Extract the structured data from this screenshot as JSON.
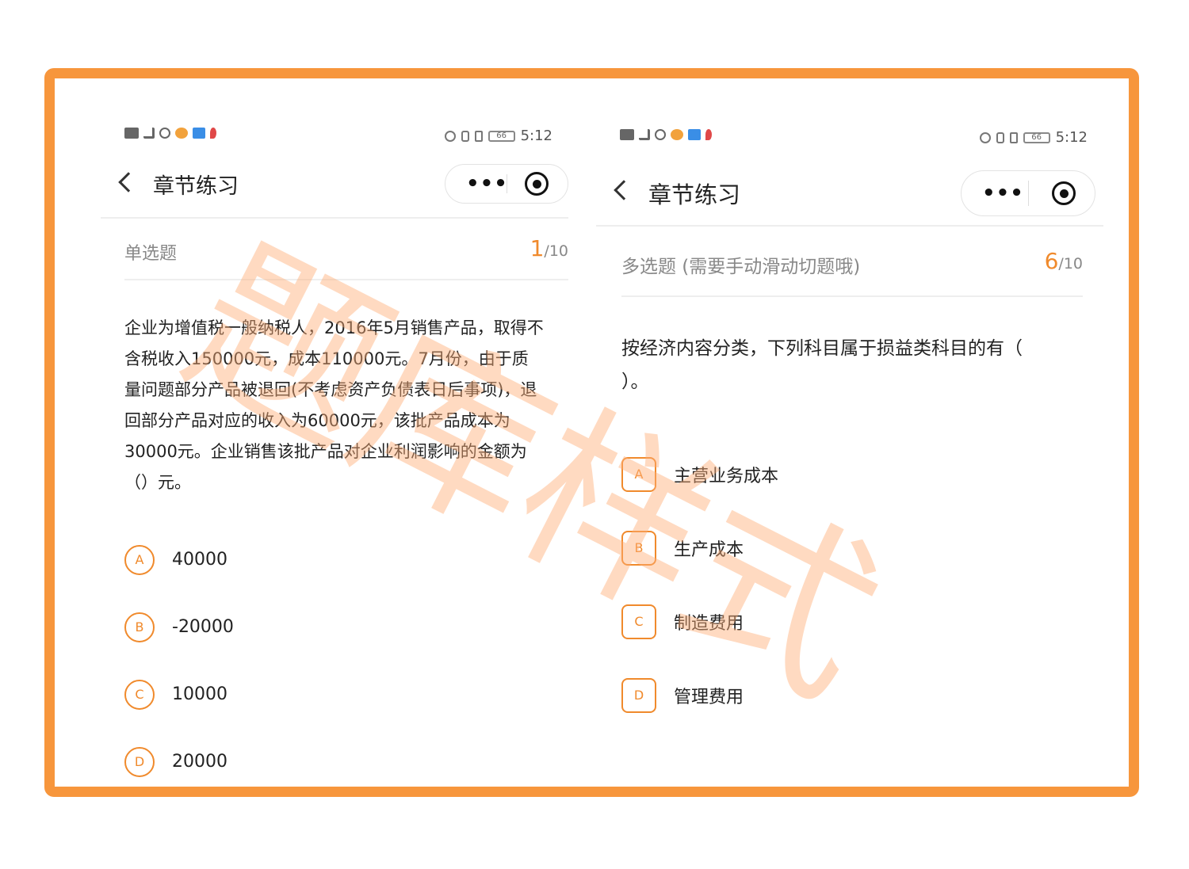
{
  "colors": {
    "frame_border": "#f7963c",
    "accent": "#f08a2c",
    "watermark": "#ffae78"
  },
  "watermark": {
    "text": "题库样式"
  },
  "left": {
    "status": {
      "time": "5:12",
      "battery": "66"
    },
    "nav": {
      "title": "章节练习",
      "more": "•••"
    },
    "question": {
      "type": "单选题",
      "index": "1",
      "total": "/10",
      "text": "企业为增值税一般纳税人，2016年5月销售产品，取得不含税收入150000元，成本110000元。7月份，由于质量问题部分产品被退回(不考虑资产负债表日后事项)，退回部分产品对应的收入为60000元，该批产品成本为30000元。企业销售该批产品对企业利润影响的金额为（）元。",
      "options": [
        {
          "letter": "A",
          "text": "40000"
        },
        {
          "letter": "B",
          "text": "-20000"
        },
        {
          "letter": "C",
          "text": "10000"
        },
        {
          "letter": "D",
          "text": "20000"
        }
      ]
    }
  },
  "right": {
    "status": {
      "time": "5:12",
      "battery": "66"
    },
    "nav": {
      "title": "章节练习",
      "more": "•••"
    },
    "question": {
      "type": "多选题 (需要手动滑动切题哦)",
      "index": "6",
      "total": "/10",
      "text": "按经济内容分类，下列科目属于损益类科目的有（ ）。",
      "options": [
        {
          "letter": "A",
          "text": "主营业务成本"
        },
        {
          "letter": "B",
          "text": "生产成本"
        },
        {
          "letter": "C",
          "text": "制造费用"
        },
        {
          "letter": "D",
          "text": "管理费用"
        }
      ]
    }
  }
}
